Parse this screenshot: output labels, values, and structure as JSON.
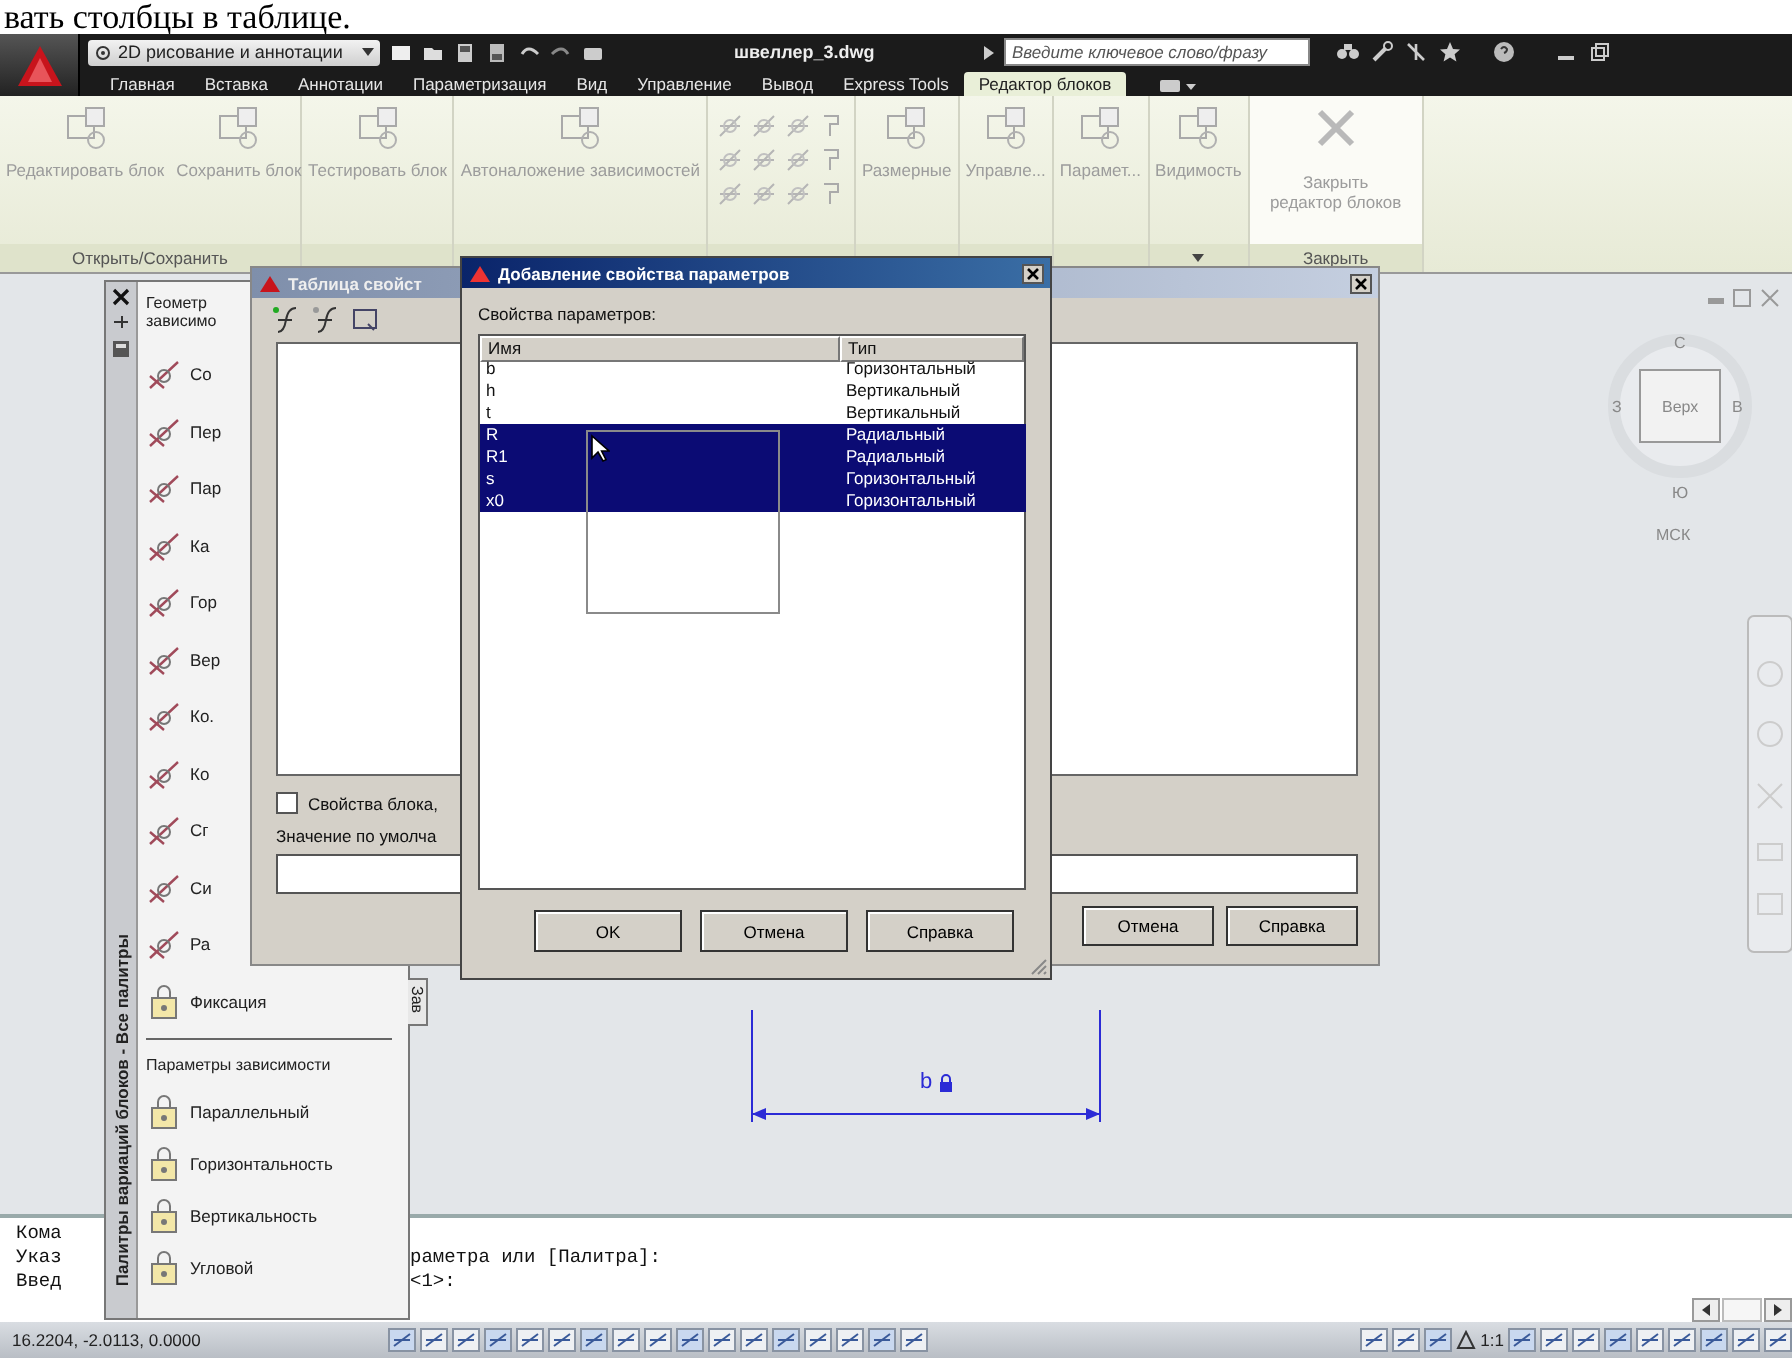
{
  "document_text": "вать столбцы в таблице.",
  "title_bar": {
    "workspace": "2D рисование и аннотации",
    "file_name": "швеллер_3.dwg",
    "search": {
      "placeholder": "Введите ключевое слово/фразу"
    }
  },
  "ribbon_tabs": [
    {
      "label": "Главная",
      "selected": false
    },
    {
      "label": "Вставка",
      "selected": false
    },
    {
      "label": "Аннотации",
      "selected": false
    },
    {
      "label": "Параметризация",
      "selected": false
    },
    {
      "label": "Вид",
      "selected": false
    },
    {
      "label": "Управление",
      "selected": false
    },
    {
      "label": "Вывод",
      "selected": false
    },
    {
      "label": "Express Tools",
      "selected": false
    },
    {
      "label": "Редактор блоков",
      "selected": true
    }
  ],
  "ribbon_panels": [
    {
      "kind": "large",
      "label": "Открыть/Сохранить",
      "buttons": [
        "Редактировать блок",
        "Сохранить блок"
      ]
    },
    {
      "kind": "large",
      "buttons": [
        "Тестировать блок"
      ]
    },
    {
      "kind": "large",
      "buttons": [
        "Автоналожение зависимостей"
      ]
    },
    {
      "kind": "tools"
    },
    {
      "kind": "large",
      "buttons": [
        "Размерные"
      ]
    },
    {
      "kind": "large",
      "buttons": [
        "Управле..."
      ]
    },
    {
      "kind": "large",
      "buttons": [
        "Парамет..."
      ]
    },
    {
      "kind": "large",
      "buttons": [
        "Видимость"
      ],
      "has_menu": true
    },
    {
      "kind": "close",
      "label": "Закрыть",
      "buttons": [
        "Закрыть редактор блоков"
      ]
    }
  ],
  "viewcube": {
    "north": "С",
    "west": "З",
    "top": "Верх",
    "east": "В",
    "south": "Ю",
    "ucs": "МСК"
  },
  "dimension_label": "b",
  "palette": {
    "title": "Палитры вариаций блоков - Все палитры",
    "side_tab": "Зав",
    "sections": [
      {
        "heading_lines": [
          "Геометр",
          "зависимо"
        ],
        "items": [
          "Со",
          "Пер",
          "Пар",
          "Ка",
          "Гор",
          "Вер",
          "Ко.",
          "Ко",
          "Сг",
          "Си",
          "Ра",
          "Фиксация"
        ]
      },
      {
        "heading_lines": [
          "Параметры зависимости"
        ],
        "items": [
          "Параллельный",
          "Горизонтальность",
          "Вертикальность",
          "Угловой"
        ]
      }
    ]
  },
  "table_window": {
    "title": "Таблица свойст",
    "checkbox": {
      "label": "Свойства блока,",
      "checked": false
    },
    "default_label": "Значение по умолча",
    "buttons": [
      "Отмена",
      "Справка"
    ]
  },
  "add_dialog": {
    "title": "Добавление свойства параметров",
    "list_label": "Свойства параметров:",
    "columns": [
      "Имя",
      "Тип"
    ],
    "rows": [
      {
        "name": "b",
        "type": "Горизонтальный",
        "selected": false
      },
      {
        "name": "h",
        "type": "Вертикальный",
        "selected": false
      },
      {
        "name": "t",
        "type": "Вертикальный",
        "selected": false
      },
      {
        "name": "R",
        "type": "Радиальный",
        "selected": true
      },
      {
        "name": "R1",
        "type": "Радиальный",
        "selected": true
      },
      {
        "name": "s",
        "type": "Горизонтальный",
        "selected": true
      },
      {
        "name": "x0",
        "type": "Горизонтальный",
        "selected": true
      }
    ],
    "buttons": [
      "OK",
      "Отмена",
      "Справка"
    ]
  },
  "command_lines": [
    {
      "left": "Кома"
    },
    {
      "left": "Указ",
      "right": "раметра или [Палитра]:"
    },
    {
      "left": "Введ",
      "right": "<1>:"
    }
  ],
  "status_bar": {
    "coordinates": "16.2204, -2.0113, 0.0000",
    "annotation_scale": "1:1"
  }
}
